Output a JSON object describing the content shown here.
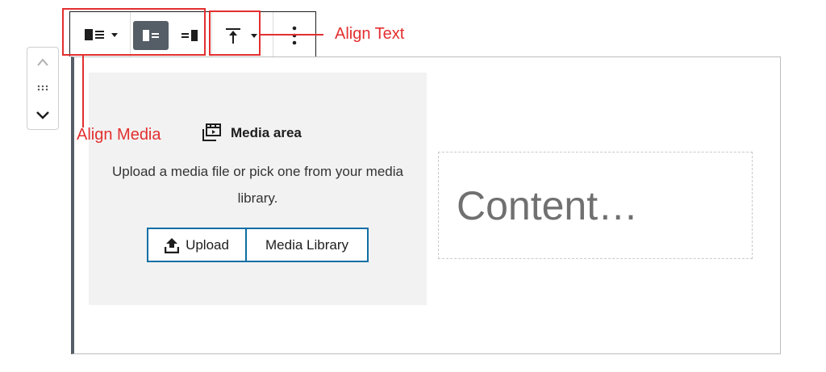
{
  "toolbar": {
    "media_align": {
      "icon": "media-left-icon",
      "dropdown_icon": "caret-down-icon"
    },
    "media_left": {
      "icon": "media-left-icon",
      "active": true
    },
    "media_right": {
      "icon": "media-right-icon"
    },
    "vertical_align": {
      "icon": "align-top-icon",
      "dropdown_icon": "caret-down-icon"
    },
    "more": {
      "icon": "more-vertical-icon"
    }
  },
  "mover": {
    "up_icon": "chevron-up-icon",
    "drag_icon": "drag-handle-icon",
    "down_icon": "chevron-down-icon"
  },
  "media_area": {
    "title": "Media area",
    "icon": "media-area-icon",
    "description": "Upload a media file or pick one from your media library.",
    "upload_label": "Upload",
    "upload_icon": "upload-icon",
    "library_label": "Media Library"
  },
  "content": {
    "placeholder": "Content…"
  },
  "annotations": {
    "align_text": "Align Text",
    "align_media": "Align Media"
  },
  "colors": {
    "annotation": "#e32f2f",
    "active_button": "#555d66",
    "button_border": "#0e6ea5"
  }
}
